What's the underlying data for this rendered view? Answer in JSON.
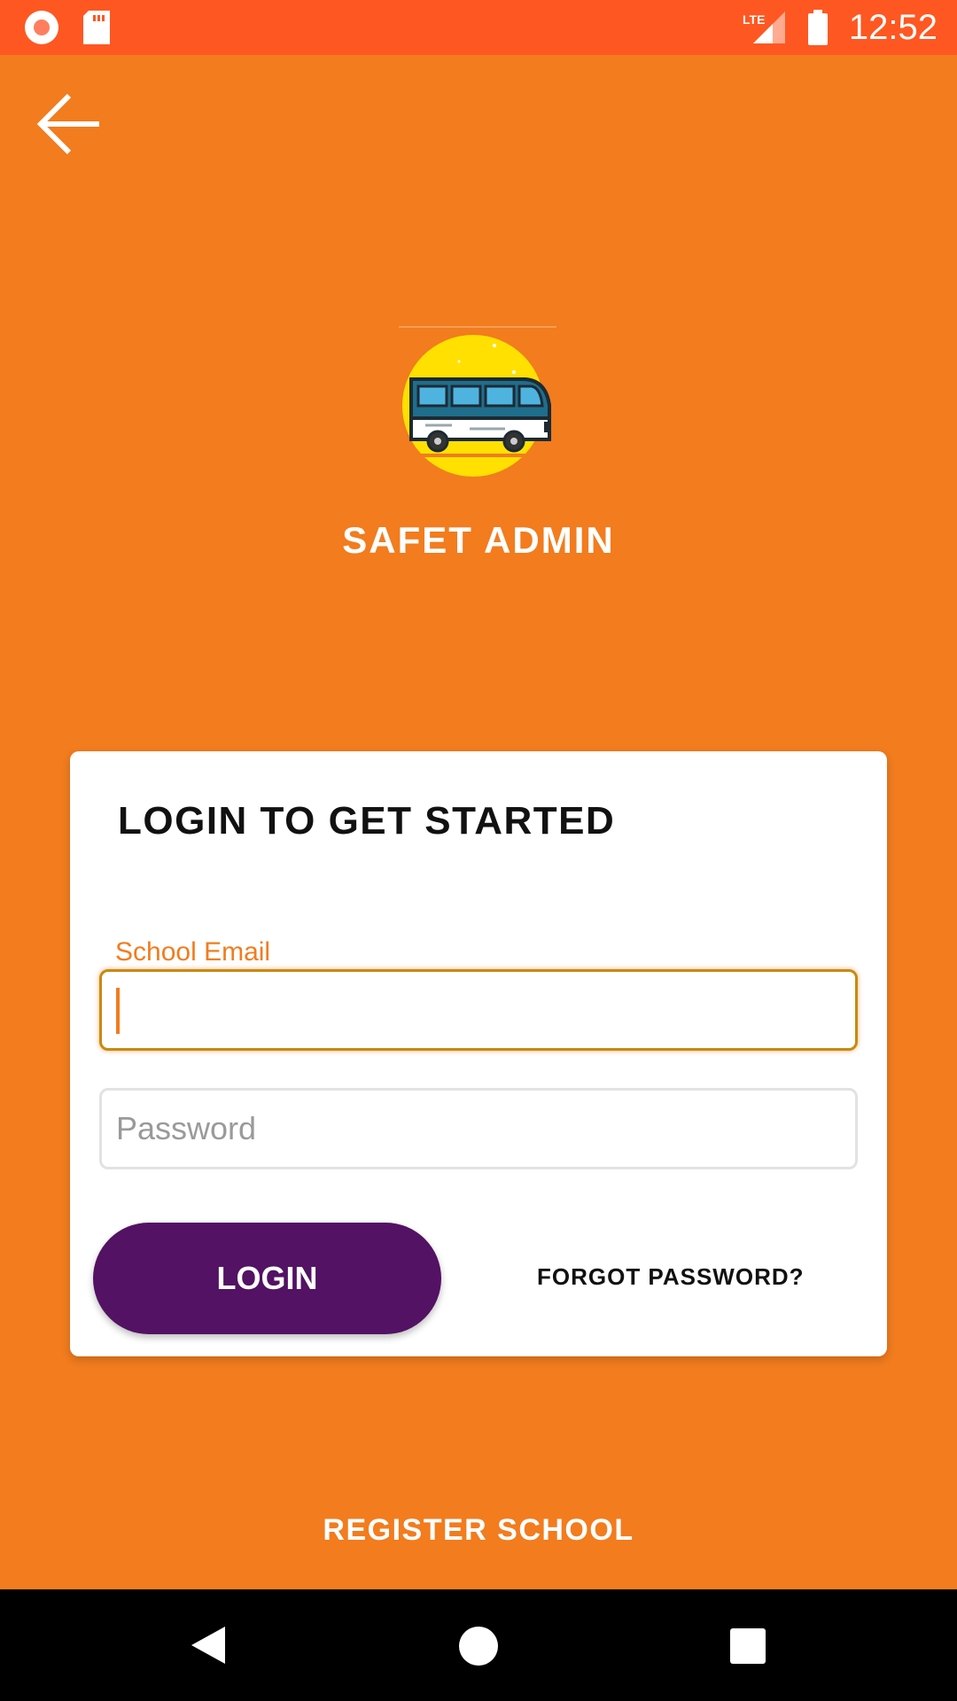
{
  "status_bar": {
    "time": "12:52",
    "network": "LTE",
    "icons": [
      "record-icon",
      "sd-card-icon",
      "signal-icon",
      "battery-icon"
    ]
  },
  "app": {
    "title": "SAFET ADMIN",
    "logo": "bus-logo-icon"
  },
  "card": {
    "title": "LOGIN TO GET STARTED",
    "email_label": "School Email",
    "email_value": "",
    "password_placeholder": "Password",
    "login_label": "LOGIN",
    "forgot_label": "FORGOT PASSWORD?"
  },
  "footer": {
    "register_label": "REGISTER SCHOOL"
  },
  "colors": {
    "background": "#F27C1E",
    "status_bar": "#FF5722",
    "button": "#531263",
    "accent": "#F27C1E"
  },
  "nav_bar": {
    "icons": [
      "back-triangle-icon",
      "home-circle-icon",
      "recents-square-icon"
    ]
  }
}
